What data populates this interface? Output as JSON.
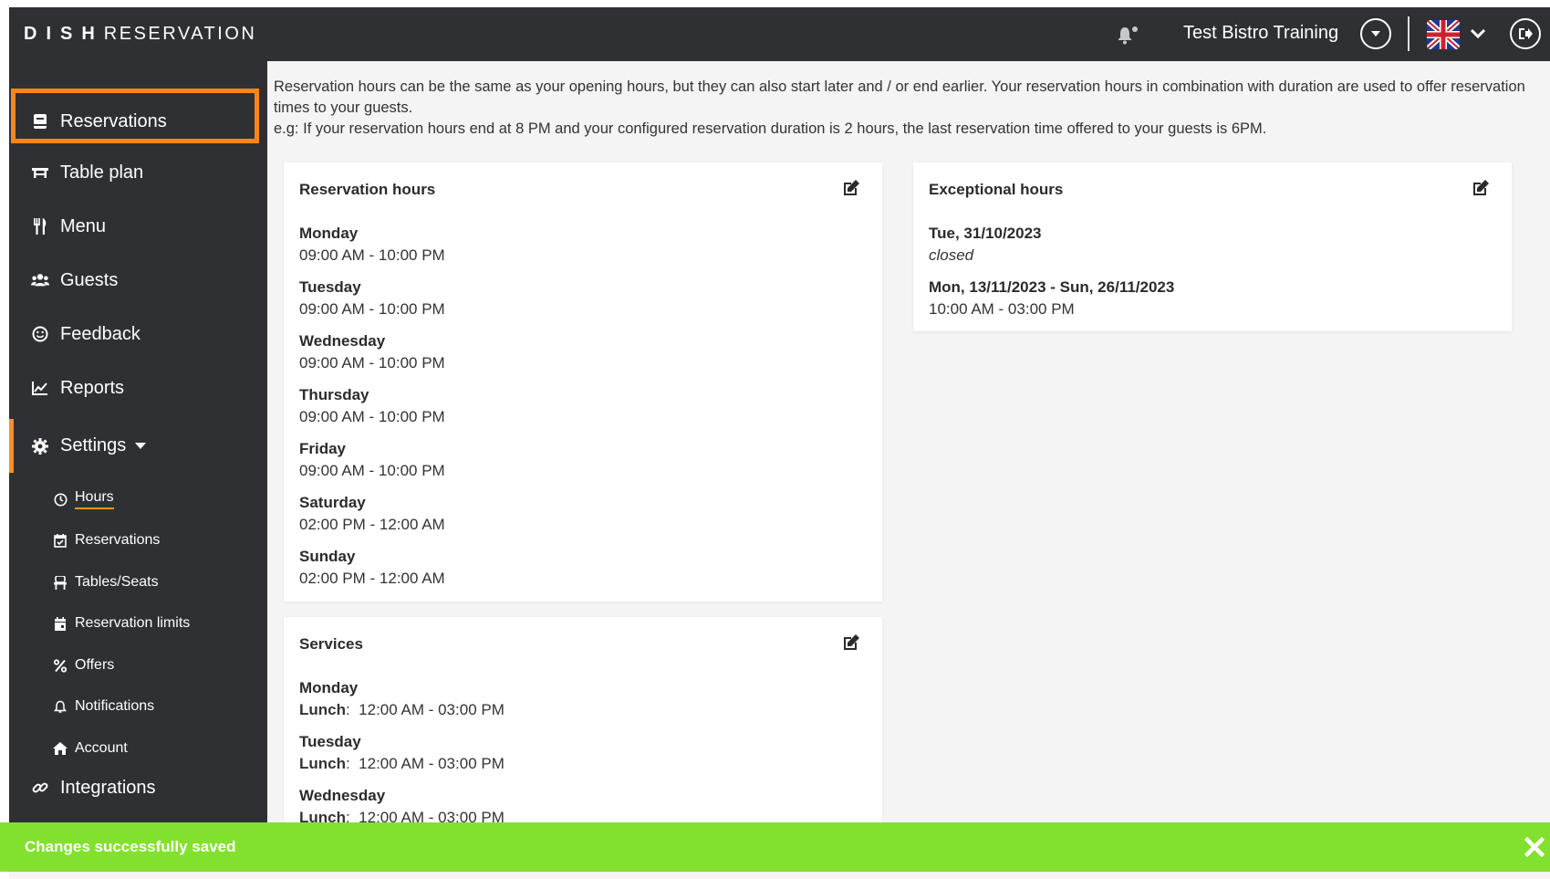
{
  "header": {
    "brand_bold": "DISH",
    "brand_light": "RESERVATION",
    "restaurant_name": "Test Bistro Training",
    "icons": [
      "bell-icon",
      "chevron-down-circle-icon",
      "uk-flag-icon",
      "chevron-down-icon",
      "logout-icon"
    ]
  },
  "sidebar": {
    "items": [
      {
        "label": "Reservations",
        "icon": "reservation-book-icon"
      },
      {
        "label": "Table plan",
        "icon": "table-icon"
      },
      {
        "label": "Menu",
        "icon": "cutlery-icon"
      },
      {
        "label": "Guests",
        "icon": "users-icon"
      },
      {
        "label": "Feedback",
        "icon": "smile-icon"
      },
      {
        "label": "Reports",
        "icon": "chart-line-icon"
      },
      {
        "label": "Settings",
        "icon": "gear-icon"
      },
      {
        "label": "Integrations",
        "icon": "link-icon"
      }
    ],
    "settings_sub": [
      {
        "label": "Hours",
        "icon": "clock-icon"
      },
      {
        "label": "Reservations",
        "icon": "calendar-check-icon"
      },
      {
        "label": "Tables/Seats",
        "icon": "chair-icon"
      },
      {
        "label": "Reservation limits",
        "icon": "calendar-icon"
      },
      {
        "label": "Offers",
        "icon": "percent-icon"
      },
      {
        "label": "Notifications",
        "icon": "bell-outline-icon"
      },
      {
        "label": "Account",
        "icon": "home-icon"
      }
    ]
  },
  "main": {
    "info_line1": "Reservation hours can be the same as your opening hours, but they can also start later and / or end earlier. Your reservation hours in combination with duration are used to offer reservation times to your guests.",
    "info_line2": "e.g: If your reservation hours end at 8 PM and your configured reservation duration is 2 hours, the last reservation time offered to your guests is 6PM.",
    "reservation_hours": {
      "title": "Reservation hours",
      "days": [
        {
          "day": "Monday",
          "time": "09:00 AM - 10:00 PM"
        },
        {
          "day": "Tuesday",
          "time": "09:00 AM - 10:00 PM"
        },
        {
          "day": "Wednesday",
          "time": "09:00 AM - 10:00 PM"
        },
        {
          "day": "Thursday",
          "time": "09:00 AM - 10:00 PM"
        },
        {
          "day": "Friday",
          "time": "09:00 AM - 10:00 PM"
        },
        {
          "day": "Saturday",
          "time": "02:00 PM - 12:00 AM"
        },
        {
          "day": "Sunday",
          "time": "02:00 PM - 12:00 AM"
        }
      ]
    },
    "exceptional_hours": {
      "title": "Exceptional hours",
      "entries": [
        {
          "date": "Tue, 31/10/2023",
          "detail": "closed"
        },
        {
          "date": "Mon, 13/11/2023 - Sun, 26/11/2023",
          "detail": "10:00 AM - 03:00 PM"
        }
      ]
    },
    "services": {
      "title": "Services",
      "days": [
        {
          "day": "Monday",
          "service": "Lunch",
          "time": "12:00 AM - 03:00 PM"
        },
        {
          "day": "Tuesday",
          "service": "Lunch",
          "time": "12:00 AM - 03:00 PM"
        },
        {
          "day": "Wednesday",
          "service": "Lunch",
          "time": "12:00 AM - 03:00 PM"
        }
      ]
    }
  },
  "toast": {
    "message": "Changes successfully saved",
    "close_icon": "close-icon"
  },
  "colors": {
    "accent": "#f7941d",
    "sidebar_bg": "#2f3033",
    "toast_bg": "#82e12f",
    "content_bg": "#f4f4f4"
  }
}
